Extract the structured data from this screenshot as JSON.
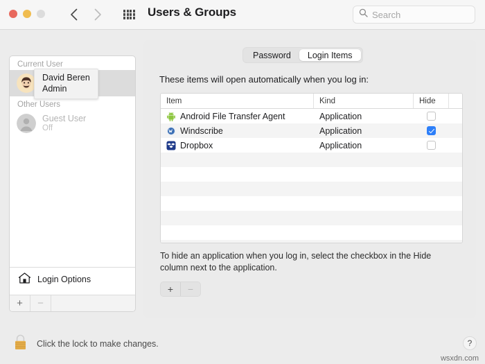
{
  "window": {
    "title": "Users & Groups",
    "traffic_lights": [
      "close-red",
      "minimize-yellow",
      "zoom-gray"
    ],
    "back_label": "‹",
    "forward_label": "›",
    "grid_icon": "grid-view-icon",
    "colors": {
      "accent_blue": "#2d7ff9",
      "close_red": "#e8695e",
      "minimize_yellow": "#f0bc4f",
      "zoom_gray": "#dcdcdc",
      "lock_gold": "#e8b04b",
      "window_bg": "#ececec",
      "panel_bg": "#ebebeb"
    }
  },
  "search": {
    "placeholder": "Search",
    "value": "",
    "icon": "search-icon"
  },
  "sidebar": {
    "groups": [
      {
        "label": "Current User",
        "users": [
          {
            "name": "David Beren",
            "sub": "Admin",
            "avatar": "memoji-avatar",
            "selected": true
          }
        ]
      },
      {
        "label": "Other Users",
        "users": [
          {
            "name": "Guest User",
            "sub": "Off",
            "avatar": "generic-person-avatar",
            "selected": false
          }
        ]
      }
    ],
    "tooltip": {
      "name": "David Beren",
      "sub": "Admin"
    },
    "login_options": {
      "label": "Login Options",
      "icon": "home-icon"
    },
    "footer": {
      "add_label": "+",
      "remove_label": "−"
    }
  },
  "main": {
    "tabs": [
      {
        "label": "Password",
        "selected": false
      },
      {
        "label": "Login Items",
        "selected": true
      }
    ],
    "intro": "These items will open automatically when you log in:",
    "table": {
      "columns": [
        "Item",
        "Kind",
        "Hide"
      ],
      "rows": [
        {
          "item": "Android File Transfer Agent",
          "kind": "Application",
          "hide": false,
          "icon": "android-icon"
        },
        {
          "item": "Windscribe",
          "kind": "Application",
          "hide": true,
          "icon": "windscribe-icon"
        },
        {
          "item": "Dropbox",
          "kind": "Application",
          "hide": false,
          "icon": "dropbox-icon"
        }
      ],
      "empty_row_count": 7
    },
    "hint": "To hide an application when you log in, select the checkbox in the Hide column next to the application.",
    "add_remove": {
      "add_label": "+",
      "remove_label": "−"
    }
  },
  "footer": {
    "lock_text": "Click the lock to make changes.",
    "lock_icon": "lock-closed-icon",
    "help_label": "?",
    "watermark": "wsxdn.com"
  }
}
